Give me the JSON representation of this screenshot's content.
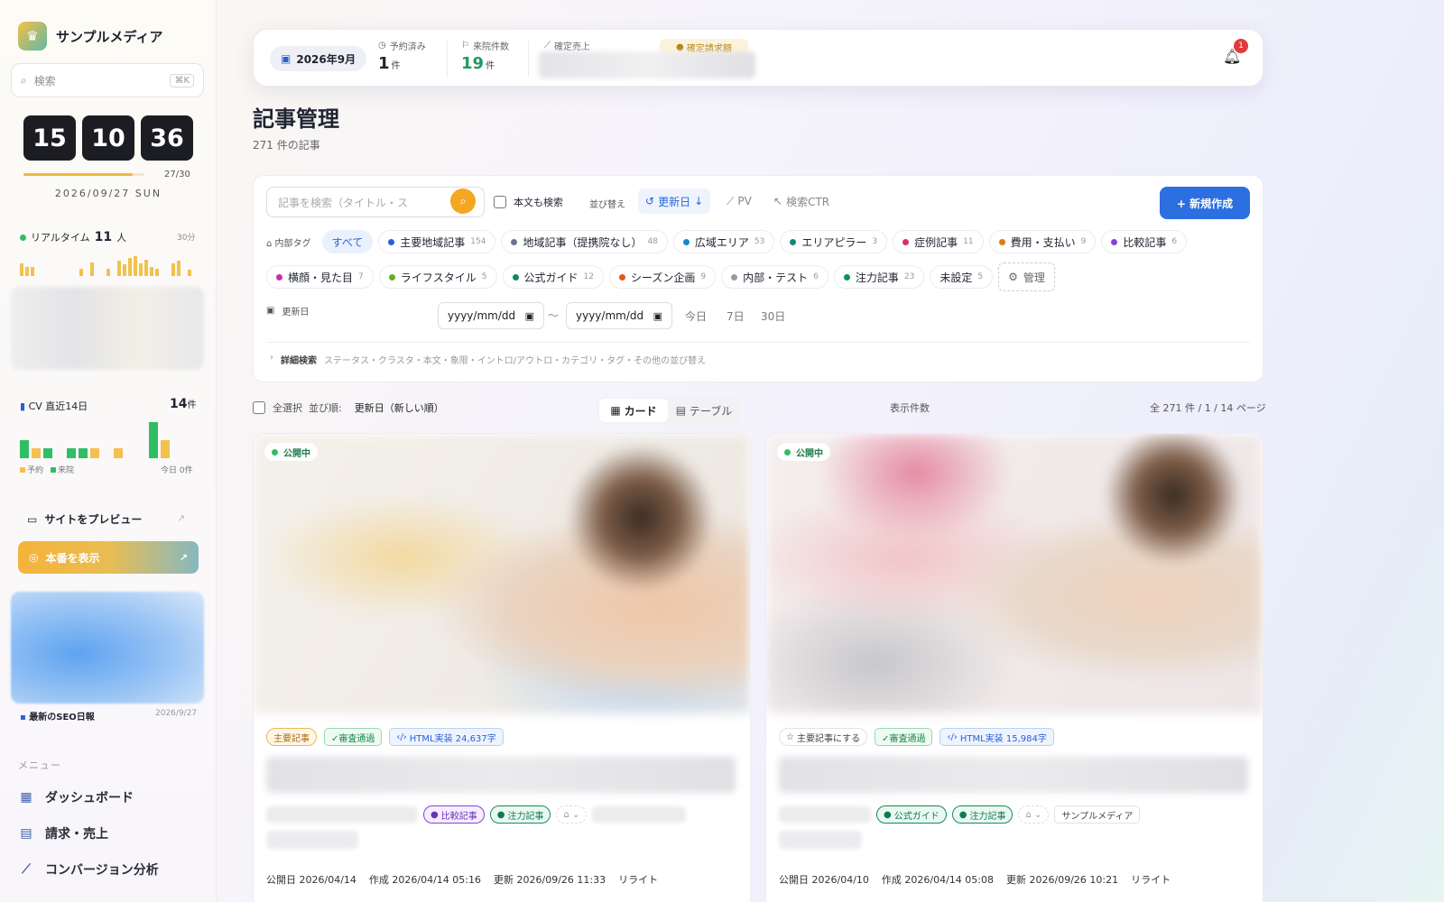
{
  "sidebar": {
    "brand": "サンプルメディア",
    "search_placeholder": "検索",
    "search_shortcut": "⌘K",
    "clock": {
      "h": "15",
      "m": "10",
      "s": "36"
    },
    "day_progress": {
      "label": "27/30",
      "value": 0.9
    },
    "date": "2026/09/27 SUN",
    "realtime": {
      "label": "リアルタイム",
      "count": "11",
      "unit": "人",
      "span": "30分",
      "spark": [
        0.5,
        0.35,
        0.35,
        0,
        0,
        0,
        0,
        0,
        0,
        0,
        0,
        0.3,
        0,
        0.55,
        0,
        0,
        0.3,
        0,
        0.6,
        0.45,
        0.7,
        0.8,
        0.5,
        0.65,
        0.35,
        0.3,
        0,
        0,
        0.5,
        0.6,
        0,
        0.25
      ]
    },
    "cv": {
      "label": "CV 直近14日",
      "count": "14",
      "unit": "件",
      "bars": [
        {
          "v": 0.45,
          "c": "#2fbe63"
        },
        {
          "v": 0.25,
          "c": "#f2c14e"
        },
        {
          "v": 0.25,
          "c": "#2fbe63"
        },
        {
          "v": 0,
          "c": "#2fbe63"
        },
        {
          "v": 0.25,
          "c": "#2fbe63"
        },
        {
          "v": 0.25,
          "c": "#2fbe63"
        },
        {
          "v": 0.25,
          "c": "#f2c14e"
        },
        {
          "v": 0,
          "c": "#f2c14e"
        },
        {
          "v": 0.25,
          "c": "#f2c14e"
        },
        {
          "v": 0,
          "c": "#f2c14e"
        },
        {
          "v": 0,
          "c": "#f2c14e"
        },
        {
          "v": 0.9,
          "c": "#2fbe63"
        },
        {
          "v": 0.45,
          "c": "#f2c14e"
        }
      ],
      "legend_booked": "予約",
      "legend_visit": "来院",
      "today": "今日 0件"
    },
    "preview_label": "サイトをプレビュー",
    "prod_label": "本番を表示",
    "seo_label": "最新のSEO日報",
    "seo_date": "2026/9/27",
    "menu_heading": "メニュー",
    "menu": [
      {
        "label": "ダッシュボード",
        "icon": "grid-icon"
      },
      {
        "label": "請求・売上",
        "icon": "invoice-icon"
      },
      {
        "label": "コンバージョン分析",
        "icon": "chart-line-icon"
      }
    ]
  },
  "topbar": {
    "month": "2026年9月",
    "booked_label": "予約済み",
    "booked_value": "1",
    "booked_unit": "件",
    "visits_label": "来院件数",
    "visits_value": "19",
    "visits_unit": "件",
    "sales_label": "確定売上",
    "invoice_label": "確定請求額",
    "notifications": "1"
  },
  "page": {
    "title": "記事管理",
    "subtitle": "271 件の記事"
  },
  "filters": {
    "search_placeholder": "記事を検索（タイトル・ス",
    "body_search": "本文も検索",
    "sort_label": "並び替え",
    "sort_updated": "更新日",
    "sort_pv": "PV",
    "sort_ctr": "検索CTR",
    "new_button": "+ 新規作成",
    "tag_label": "内部タグ",
    "tag_all": "すべて",
    "tags_row1": [
      {
        "name": "主要地域記事",
        "count": "154",
        "color": "#2b5fd6"
      },
      {
        "name": "地域記事（提携院なし）",
        "count": "48",
        "color": "#6b7390"
      },
      {
        "name": "広域エリア",
        "count": "53",
        "color": "#1488c9"
      },
      {
        "name": "エリアピラー",
        "count": "3",
        "color": "#0f8a74"
      },
      {
        "name": "症例記事",
        "count": "11",
        "color": "#d62f6a"
      },
      {
        "name": "費用・支払い",
        "count": "9",
        "color": "#e07b12"
      },
      {
        "name": "比較記事",
        "count": "6",
        "color": "#8544d6"
      }
    ],
    "tags_row2": [
      {
        "name": "横顔・見た目",
        "count": "7",
        "color": "#c22fb0"
      },
      {
        "name": "ライフスタイル",
        "count": "5",
        "color": "#62b01e"
      },
      {
        "name": "公式ガイド",
        "count": "12",
        "color": "#0f8a5a"
      },
      {
        "name": "シーズン企画",
        "count": "9",
        "color": "#e0581a"
      },
      {
        "name": "内部・テスト",
        "count": "6",
        "color": "#9a9aa3"
      },
      {
        "name": "注力記事",
        "count": "23",
        "color": "#0f9060"
      },
      {
        "name": "未設定",
        "count": "5",
        "color": ""
      }
    ],
    "manage": "管理",
    "date_label": "更新日",
    "date_placeholder": "yyyy/mm/dd",
    "tilde": "〜",
    "quick": [
      "今日",
      "7日",
      "30日"
    ],
    "advanced_label": "詳細検索",
    "advanced_hint": "ステータス・クラスタ・本文・象限・イントロ/アウトロ・カテゴリ・タグ・その他の並び替え"
  },
  "list": {
    "select_all": "全選択",
    "order_label": "並び順:",
    "order_value": "更新日（新しい順）",
    "view_card": "カード",
    "view_table": "テーブル",
    "per_page_label": "表示件数",
    "summary": "全 271 件 / 1 / 14 ページ"
  },
  "cards": [
    {
      "status": "公開中",
      "featured": "主要記事",
      "review": "✓審査通過",
      "html": "HTML実装 24,637字",
      "chips": [
        {
          "name": "比較記事",
          "color": "#8544d6"
        },
        {
          "name": "注力記事",
          "color": "#0f9060"
        }
      ],
      "site": "",
      "published": "公開日 2026/04/14",
      "created": "作成 2026/04/14 05:16",
      "updated": "更新 2026/09/26 11:33",
      "rewrite": "リライト"
    },
    {
      "status": "公開中",
      "featured": "主要記事にする",
      "review": "✓審査通過",
      "html": "HTML実装 15,984字",
      "chips": [
        {
          "name": "公式ガイド",
          "color": "#0f8a5a"
        },
        {
          "name": "注力記事",
          "color": "#0f9060"
        }
      ],
      "site": "サンプルメディア",
      "published": "公開日 2026/04/10",
      "created": "作成 2026/04/14 05:08",
      "updated": "更新 2026/09/26 10:21",
      "rewrite": "リライト"
    }
  ]
}
